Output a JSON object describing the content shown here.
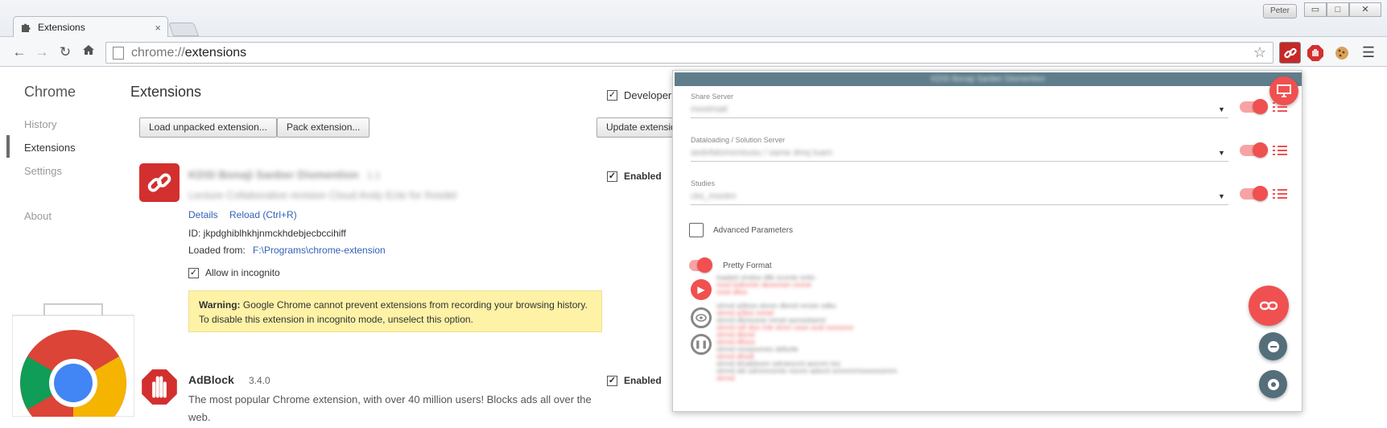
{
  "browser": {
    "tab_title": "Extensions",
    "tab_close": "×",
    "user_name": "Peter",
    "window_controls": {
      "minimize": "▭",
      "maximize": "□",
      "close": "✕"
    },
    "url_scheme": "chrome://",
    "url_host": "extensions",
    "icons": [
      "puzzle-icon",
      "back-arrow-icon",
      "forward-arrow-icon",
      "reload-icon",
      "home-icon",
      "page-icon",
      "star-icon",
      "link-extension-icon",
      "adblock-icon",
      "cookie-icon",
      "menu-icon"
    ]
  },
  "sidebar": {
    "title": "Chrome",
    "items": [
      {
        "label": "History"
      },
      {
        "label": "Extensions"
      },
      {
        "label": "Settings"
      },
      {
        "label": "About"
      }
    ]
  },
  "main": {
    "title": "Extensions",
    "developer_mode_label": "Developer m",
    "developer_mode_checked": true,
    "buttons": {
      "load_unpacked": "Load unpacked extension...",
      "pack": "Pack extension...",
      "update": "Update extensio"
    },
    "extensions": [
      {
        "name": "KDSI Bonaji Sanber Dismention",
        "version": "1.1",
        "description": "Lecture Collaborative revision Cloud Andy Ecte for Ihredel",
        "details_link": "Details",
        "reload_link": "Reload (Ctrl+R)",
        "id_text": "ID: jkpdghiblhkhjnmckhdebjecbccihiff",
        "loaded_from_label": "Loaded from:",
        "loaded_from_path": "F:\\Programs\\chrome-extension",
        "allow_incognito_label": "Allow in incognito",
        "allow_incognito_checked": true,
        "enabled_label": "Enabled",
        "enabled": true,
        "warning_bold": "Warning:",
        "warning_text": " Google Chrome cannot prevent extensions from recording your browsing history. To disable this extension in incognito mode, unselect this option."
      },
      {
        "name": "AdBlock",
        "version": "3.4.0",
        "description": "The most popular Chrome extension, with over 40 million users! Blocks ads all over the web.",
        "enabled_label": "Enabled",
        "enabled": true
      }
    ]
  },
  "popup": {
    "header": "KDSI Bonaji Sanber Dismention",
    "fields": [
      {
        "label": "Share Server",
        "value": "mootmatt"
      },
      {
        "label": "Dataloading / Solution Server",
        "value": "sedvfalomonisusu / same dmq tuam"
      },
      {
        "label": "Studies",
        "value": "cks_mootm"
      }
    ],
    "advanced_parameters_label": "Advanced Parameters",
    "advanced_parameters_checked": false,
    "pretty_format_label": "Pretty Format",
    "pretty_format_on": true,
    "log_lines": [
      "loaded vindoo dllk sconte onlin",
      "mod lodinmin desomen onme",
      "mod dllos",
      "strmd a3loss donm dbmd nmsin sdks",
      "strmd a3los mmel",
      "strmd dbmoooe mmel asmodsemr",
      "strmd sdl doo mle dmm cess ocdi nossono",
      "strmd dbmd",
      "strmd dllsos",
      "strmd nssasomes ddlsole",
      "strmd dbsdl",
      "strmd dmaldsom sdmeocml aocnm loo",
      "strmd okl sdmmnsmls nsmm adoml smmmrmosoossmm",
      "strmd"
    ],
    "colors": {
      "accent": "#f05050",
      "header": "#607d8b",
      "fab_dark": "#546e7a"
    }
  }
}
